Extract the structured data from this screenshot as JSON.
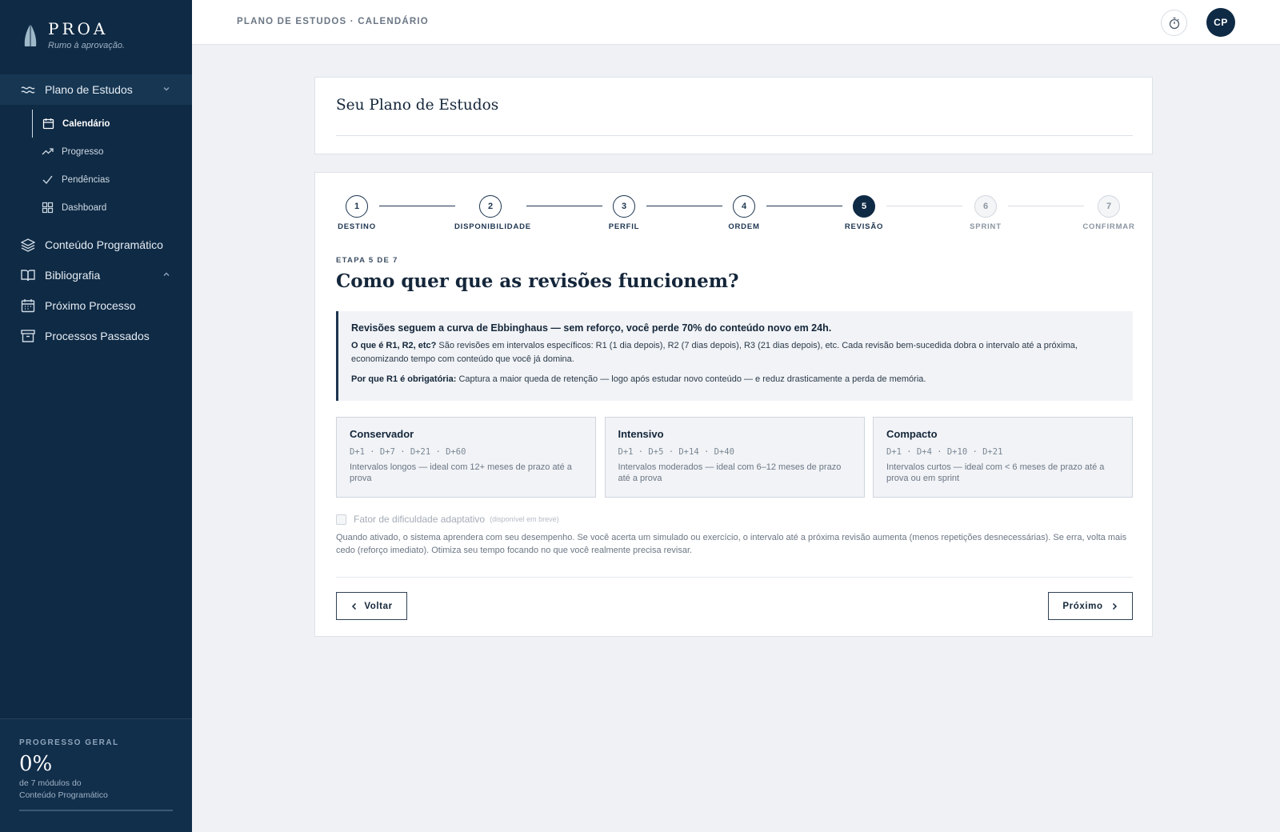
{
  "brand": {
    "name": "PROA",
    "tagline": "Rumo à aprovação."
  },
  "sidebar": {
    "sections": [
      {
        "label": "Plano de Estudos",
        "icon": "waves-icon",
        "expanded": true
      },
      {
        "label": "Conteúdo Programático",
        "icon": "layers-icon"
      },
      {
        "label": "Bibliografia",
        "icon": "book-icon"
      },
      {
        "label": "Próximo Processo",
        "icon": "calendar-icon"
      },
      {
        "label": "Processos Passados",
        "icon": "archive-icon"
      }
    ],
    "sub_items": [
      {
        "label": "Calendário",
        "icon": "calendar-icon",
        "current": true
      },
      {
        "label": "Progresso",
        "icon": "trending-up-icon"
      },
      {
        "label": "Pendências",
        "icon": "check-icon"
      },
      {
        "label": "Dashboard",
        "icon": "grid-icon"
      }
    ],
    "progress": {
      "label": "PROGRESSO GERAL",
      "value": "0%",
      "fraction": 0,
      "desc_line1": "de 7 módulos do",
      "desc_line2": "Conteúdo Programático"
    }
  },
  "topbar": {
    "breadcrumb": "PLANO DE ESTUDOS · CALENDÁRIO",
    "timer_icon": "stopwatch-icon",
    "avatar_initials": "CP"
  },
  "page": {
    "title": "Seu Plano de Estudos"
  },
  "wizard": {
    "steps": [
      {
        "n": "1",
        "label": "DESTINO",
        "state": "done"
      },
      {
        "n": "2",
        "label": "DISPONIBILIDADE",
        "state": "done"
      },
      {
        "n": "3",
        "label": "PERFIL",
        "state": "done"
      },
      {
        "n": "4",
        "label": "ORDEM",
        "state": "done"
      },
      {
        "n": "5",
        "label": "REVISÃO",
        "state": "current"
      },
      {
        "n": "6",
        "label": "SPRINT",
        "state": "pending"
      },
      {
        "n": "7",
        "label": "CONFIRMAR",
        "state": "pending"
      }
    ],
    "eyebrow": "ETAPA 5 DE 7",
    "question": "Como quer que as revisões funcionem?",
    "info": {
      "lead": "Revisões seguem a curva de Ebbinghaus — sem reforço, você perde 70% do conteúdo novo em 24h.",
      "p1_bold": "O que é R1, R2, etc?",
      "p1_text": " São revisões em intervalos específicos: R1 (1 dia depois), R2 (7 dias depois), R3 (21 dias depois), etc. Cada revisão bem-sucedida dobra o intervalo até a próxima, economizando tempo com conteúdo que você já domina.",
      "p2_bold": "Por que R1 é obrigatória:",
      "p2_text": " Captura a maior queda de retenção — logo após estudar novo conteúdo — e reduz drasticamente a perda de memória."
    },
    "options": [
      {
        "name": "Conservador",
        "intervals": "D+1 · D+7 · D+21 · D+60",
        "desc": "Intervalos longos — ideal com 12+ meses de prazo até a prova"
      },
      {
        "name": "Intensivo",
        "intervals": "D+1 · D+5 · D+14 · D+40",
        "desc": "Intervalos moderados — ideal com 6–12 meses de prazo até a prova"
      },
      {
        "name": "Compacto",
        "intervals": "D+1 · D+4 · D+10 · D+21",
        "desc": "Intervalos curtos — ideal com < 6 meses de prazo até a prova ou em sprint"
      }
    ],
    "adaptive": {
      "label": "Fator de dificuldade adaptativo",
      "note": "(disponível em breve)",
      "checked": false,
      "desc": "Quando ativado, o sistema aprendera com seu desempenho. Se você acerta um simulado ou exercício, o intervalo até a próxima revisão aumenta (menos repetições desnecessárias). Se erra, volta mais cedo (reforço imediato). Otimiza seu tempo focando no que você realmente precisa revisar."
    },
    "back_label": "Voltar",
    "next_label": "Próximo"
  },
  "colors": {
    "sidebar_bg": "#0f2a44",
    "accent": "#0f2a44",
    "page_bg": "#eff1f4"
  }
}
